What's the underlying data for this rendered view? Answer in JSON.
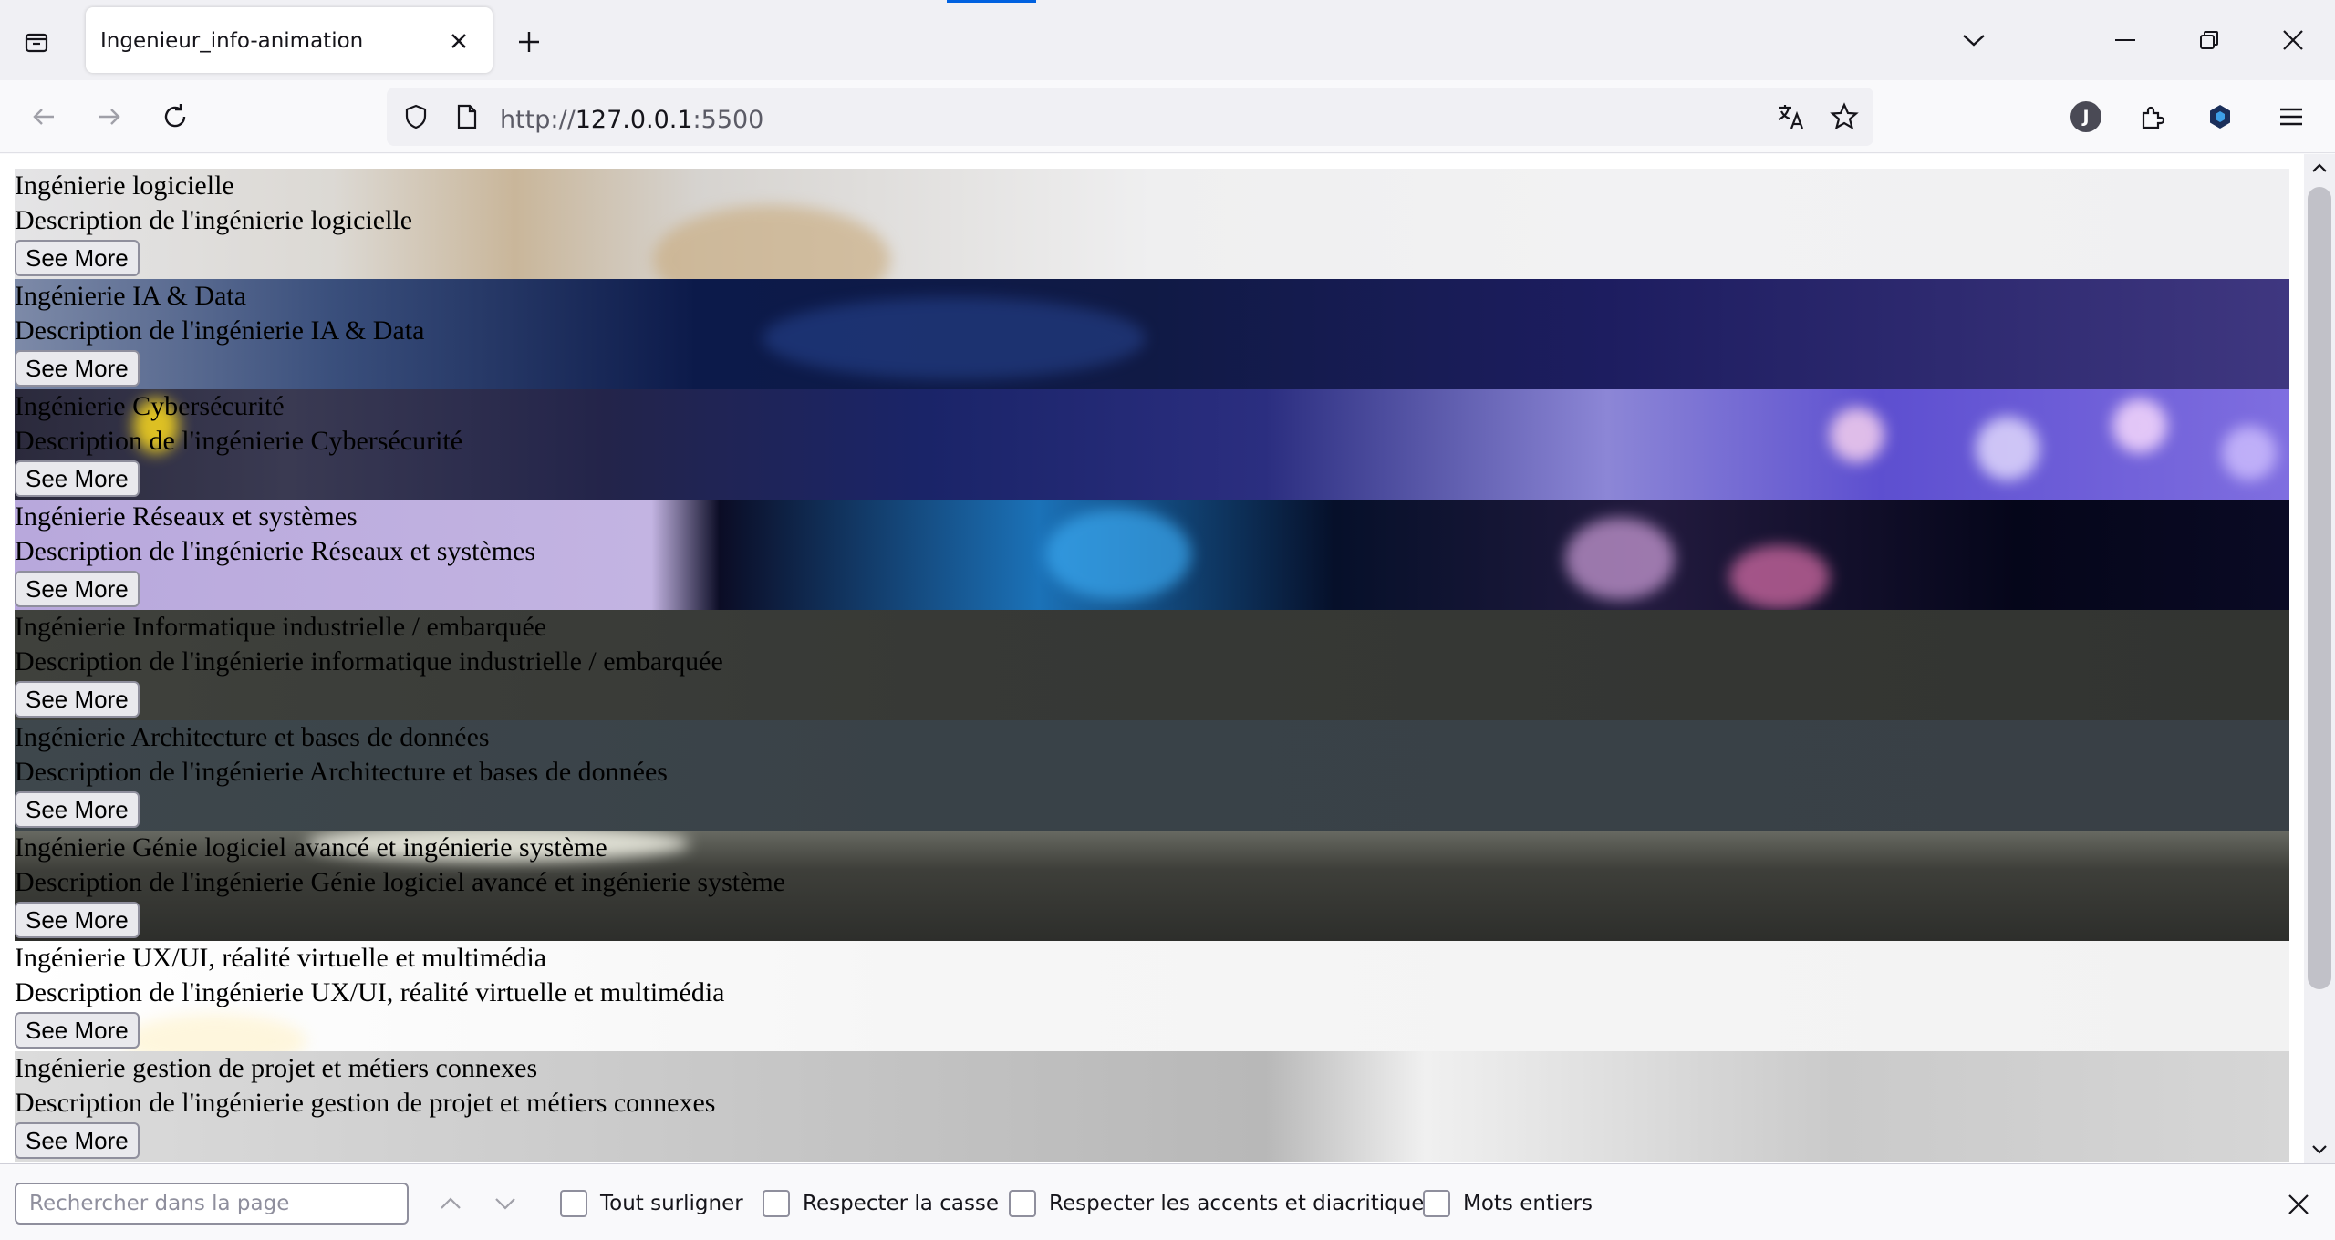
{
  "browser": {
    "tab": {
      "title": "Ingenieur_info-animation"
    },
    "url": {
      "scheme": "http://",
      "host": "127.0.0.1",
      "port": ":5500"
    },
    "profile_initial": "J",
    "accent": "#0061e0"
  },
  "cards": [
    {
      "title": "Ingénierie logicielle",
      "description": "Description de l'ingénierie logicielle",
      "button": "See More"
    },
    {
      "title": "Ingénierie IA & Data",
      "description": "Description de l'ingénierie IA & Data",
      "button": "See More"
    },
    {
      "title": "Ingénierie Cybersécurité",
      "description": "Description de l'ingénierie Cybersécurité",
      "button": "See More"
    },
    {
      "title": "Ingénierie Réseaux et systèmes",
      "description": "Description de l'ingénierie Réseaux et systèmes",
      "button": "See More"
    },
    {
      "title": "Ingénierie Informatique industrielle / embarquée",
      "description": "Description de l'ingénierie informatique industrielle / embarquée",
      "button": "See More"
    },
    {
      "title": "Ingénierie Architecture et bases de données",
      "description": "Description de l'ingénierie Architecture et bases de données",
      "button": "See More"
    },
    {
      "title": "Ingénierie Génie logiciel avancé et ingénierie système",
      "description": "Description de l'ingénierie Génie logiciel avancé et ingénierie système",
      "button": "See More"
    },
    {
      "title": "Ingénierie UX/UI, réalité virtuelle et multimédia",
      "description": "Description de l'ingénierie UX/UI, réalité virtuelle et multimédia",
      "button": "See More"
    },
    {
      "title": "Ingénierie gestion de projet et métiers connexes",
      "description": "Description de l'ingénierie gestion de projet et métiers connexes",
      "button": "See More"
    }
  ],
  "findbar": {
    "placeholder": "Rechercher dans la page",
    "options": {
      "highlight_all": "Tout surligner",
      "match_case": "Respecter la casse",
      "match_diacritics": "Respecter les accents et diacritiques",
      "whole_words": "Mots entiers"
    }
  }
}
